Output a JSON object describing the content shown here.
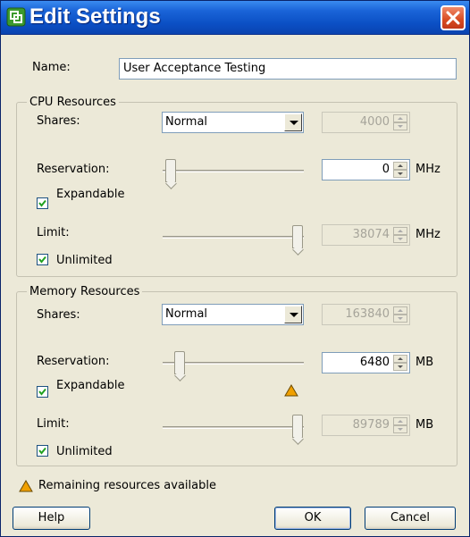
{
  "window": {
    "title": "Edit Settings",
    "close_label": "×",
    "app_icon": "vmware-resource-pool-icon",
    "close_icon": "close-icon"
  },
  "name_field": {
    "label": "Name:",
    "value": "User Acceptance Testing"
  },
  "cpu": {
    "group_title": "CPU Resources",
    "shares_label": "Shares:",
    "shares_value": "Normal",
    "shares_number": "4000",
    "reservation_label": "Reservation:",
    "reservation_value": "0",
    "reservation_unit": "MHz",
    "reservation_fraction": 0.0,
    "expandable_label": "Expandable",
    "expandable_checked": true,
    "limit_label": "Limit:",
    "limit_value": "38074",
    "limit_unit": "MHz",
    "limit_fraction": 1.0,
    "unlimited_label": "Unlimited",
    "unlimited_checked": true
  },
  "memory": {
    "group_title": "Memory Resources",
    "shares_label": "Shares:",
    "shares_value": "Normal",
    "shares_number": "163840",
    "reservation_label": "Reservation:",
    "reservation_value": "6480",
    "reservation_unit": "MB",
    "reservation_fraction": 0.072,
    "expandable_label": "Expandable",
    "expandable_checked": true,
    "limit_label": "Limit:",
    "limit_value": "89789",
    "limit_unit": "MB",
    "limit_fraction": 1.0,
    "unlimited_label": "Unlimited",
    "unlimited_checked": true
  },
  "footer": {
    "legend_text": "Remaining resources available",
    "warning_icon": "warning-triangle-icon",
    "help_label": "Help",
    "ok_label": "OK",
    "cancel_label": "Cancel"
  },
  "colors": {
    "titlebar": "#0b4fc4",
    "warning": "#f0a000"
  }
}
